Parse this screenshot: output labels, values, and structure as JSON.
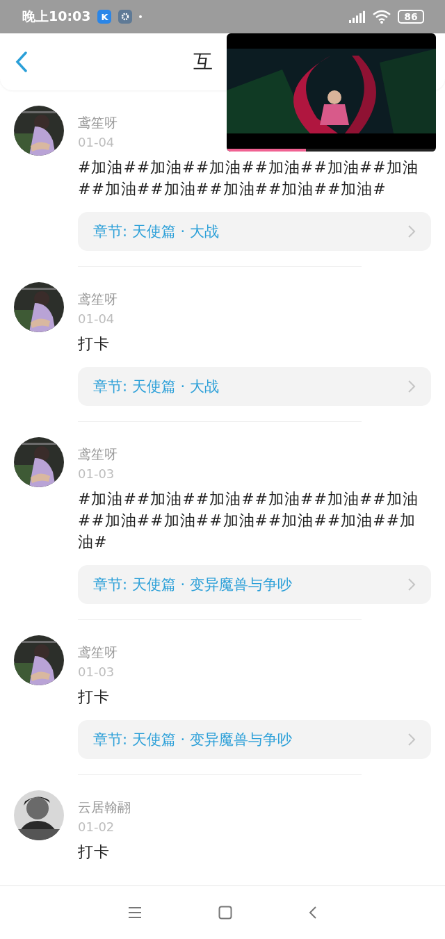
{
  "status_bar": {
    "time": "晚上10:03",
    "app_badge": "K",
    "battery": "86"
  },
  "header": {
    "title": "互"
  },
  "video_overlay": {
    "kind": "picture",
    "level": 0.38
  },
  "posts": [
    {
      "author": "鸢笙呀",
      "date": "01-04",
      "content": "#加油##加油##加油##加油##加油##加油##加油##加油##加油##加油##加油#",
      "chapter": "章节: 天使篇 · 大战"
    },
    {
      "author": "鸢笙呀",
      "date": "01-04",
      "content": "打卡",
      "chapter": "章节: 天使篇 · 大战"
    },
    {
      "author": "鸢笙呀",
      "date": "01-03",
      "content": "#加油##加油##加油##加油##加油##加油##加油##加油##加油##加油##加油##加油#",
      "chapter": "章节: 天使篇 · 变异魔兽与争吵"
    },
    {
      "author": "鸢笙呀",
      "date": "01-03",
      "content": "打卡",
      "chapter": "章节: 天使篇 · 变异魔兽与争吵"
    },
    {
      "author": "云居翰翮",
      "date": "01-02",
      "content": "打卡"
    }
  ]
}
